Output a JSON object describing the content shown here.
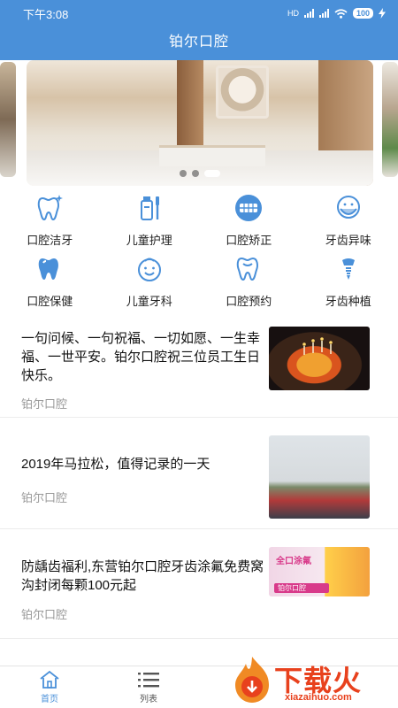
{
  "status_bar": {
    "time": "下午3:08",
    "network": "HD",
    "battery": "100"
  },
  "app": {
    "title": "铂尔口腔"
  },
  "banner": {
    "dots": 3,
    "active_dot": 2
  },
  "services": [
    {
      "label": "口腔洁牙",
      "icon": "tooth-sparkle-icon"
    },
    {
      "label": "儿童护理",
      "icon": "toothpaste-brush-icon"
    },
    {
      "label": "口腔矫正",
      "icon": "braces-icon"
    },
    {
      "label": "牙齿异味",
      "icon": "face-mask-icon"
    },
    {
      "label": "口腔保健",
      "icon": "tooth-shield-icon"
    },
    {
      "label": "儿童牙科",
      "icon": "child-face-icon"
    },
    {
      "label": "口腔预约",
      "icon": "tooth-calendar-icon"
    },
    {
      "label": "牙齿种植",
      "icon": "implant-icon"
    }
  ],
  "news": [
    {
      "title": "一句问候、一句祝福、一切如愿、一生幸福、一世平安。铂尔口腔祝三位员工生日快乐。",
      "source": "铂尔口腔"
    },
    {
      "title": "2019年马拉松，值得记录的一天",
      "source": "铂尔口腔"
    },
    {
      "title": "防龋齿福利,东营铂尔口腔牙齿涂氟免费窝沟封闭每颗100元起",
      "source": "铂尔口腔",
      "thumb_text": {
        "heading": "全口涂氟",
        "brand": "铂尔口腔"
      }
    }
  ],
  "tabs": [
    {
      "label": "首页",
      "icon": "home-icon"
    },
    {
      "label": "列表",
      "icon": "list-icon"
    }
  ],
  "watermark": {
    "text": "下载火",
    "url": "xiazaihuo.com"
  },
  "colors": {
    "primary": "#4a90d9",
    "watermark": "#e8411d"
  }
}
